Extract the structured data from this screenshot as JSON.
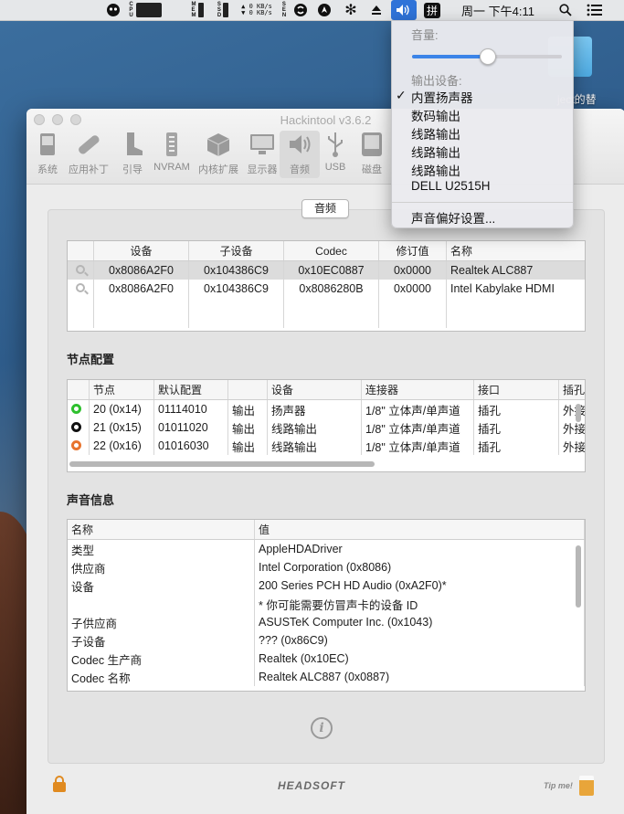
{
  "desktop": {
    "folder_label": "ject的替"
  },
  "menubar": {
    "cpu_label": "CPU",
    "mem_label": "MEM",
    "ssd_label": "SSD",
    "net_up": "0 KB/s",
    "net_down": "0 KB/s",
    "sen_label": "SEN",
    "input_method": "拼",
    "clock": "周一 下午4:11",
    "icons": [
      "ghost-icon",
      "cpu-graph-icon",
      "memory-icon",
      "ssd-icon",
      "network-icon",
      "sensor-icon",
      "shazam-icon",
      "maps-icon",
      "paw-icon",
      "eject-icon",
      "volume-icon",
      "input-method-icon",
      "search-icon",
      "list-icon"
    ]
  },
  "sound_menu": {
    "volume_header": "音量:",
    "volume_level": 0.5,
    "output_header": "输出设备:",
    "devices": [
      "内置扬声器",
      "数码输出",
      "线路输出",
      "线路输出",
      "线路输出",
      "DELL U2515H"
    ],
    "selected_index": 0,
    "check_mark": "✓",
    "preferences": "声音偏好设置..."
  },
  "window": {
    "title": "Hackintool v3.6.2",
    "toolbar": [
      {
        "label": "系统"
      },
      {
        "label": "应用补丁"
      },
      {
        "label": "引导"
      },
      {
        "label": "NVRAM"
      },
      {
        "label": "内核扩展"
      },
      {
        "label": "显示器"
      },
      {
        "label": "音频"
      },
      {
        "label": "USB"
      },
      {
        "label": "磁盘"
      }
    ],
    "active_tab": "音频",
    "segment_label": "音频"
  },
  "devices_table": {
    "headers": [
      "设备",
      "子设备",
      "Codec",
      "修订值",
      "名称"
    ],
    "rows": [
      {
        "device": "0x8086A2F0",
        "subdevice": "0x104386C9",
        "codec": "0x10EC0887",
        "revision": "0x0000",
        "name": "Realtek ALC887"
      },
      {
        "device": "0x8086A2F0",
        "subdevice": "0x104386C9",
        "codec": "0x8086280B",
        "revision": "0x0000",
        "name": "Intel Kabylake HDMI"
      }
    ]
  },
  "node_section": {
    "title": "节点配置"
  },
  "node_table": {
    "headers": [
      "节点",
      "默认配置",
      "",
      "设备",
      "连接器",
      "接口",
      "插孔"
    ],
    "rows": [
      {
        "color": "#2ec02e",
        "node": "20 (0x14)",
        "config": "01114010",
        "dir": "输出",
        "device": "扬声器",
        "connector": "1/8\" 立体声/单声道",
        "port": "插孔",
        "jack": "外接"
      },
      {
        "color": "#111111",
        "node": "21 (0x15)",
        "config": "01011020",
        "dir": "输出",
        "device": "线路输出",
        "connector": "1/8\" 立体声/单声道",
        "port": "插孔",
        "jack": "外接"
      },
      {
        "color": "#e8742e",
        "node": "22 (0x16)",
        "config": "01016030",
        "dir": "输出",
        "device": "线路输出",
        "connector": "1/8\" 立体声/单声道",
        "port": "插孔",
        "jack": "外接"
      }
    ]
  },
  "info_section": {
    "title": "声音信息"
  },
  "info_table": {
    "headers": [
      "名称",
      "值"
    ],
    "rows": [
      {
        "name": "类型",
        "value": "AppleHDADriver"
      },
      {
        "name": "供应商",
        "value": "Intel Corporation (0x8086)"
      },
      {
        "name": "设备",
        "value": "200 Series PCH HD Audio (0xA2F0)*"
      },
      {
        "name": "",
        "value": "* 你可能需要仿冒声卡的设备 ID"
      },
      {
        "name": "子供应商",
        "value": "ASUSTeK Computer Inc. (0x1043)"
      },
      {
        "name": "子设备",
        "value": "??? (0x86C9)"
      },
      {
        "name": "Codec 生产商",
        "value": "Realtek (0x10EC)"
      },
      {
        "name": "Codec 名称",
        "value": "Realtek ALC887 (0x0887)"
      }
    ]
  },
  "footer": {
    "brand": "HEADSOFT",
    "tip": "Tip me!"
  }
}
